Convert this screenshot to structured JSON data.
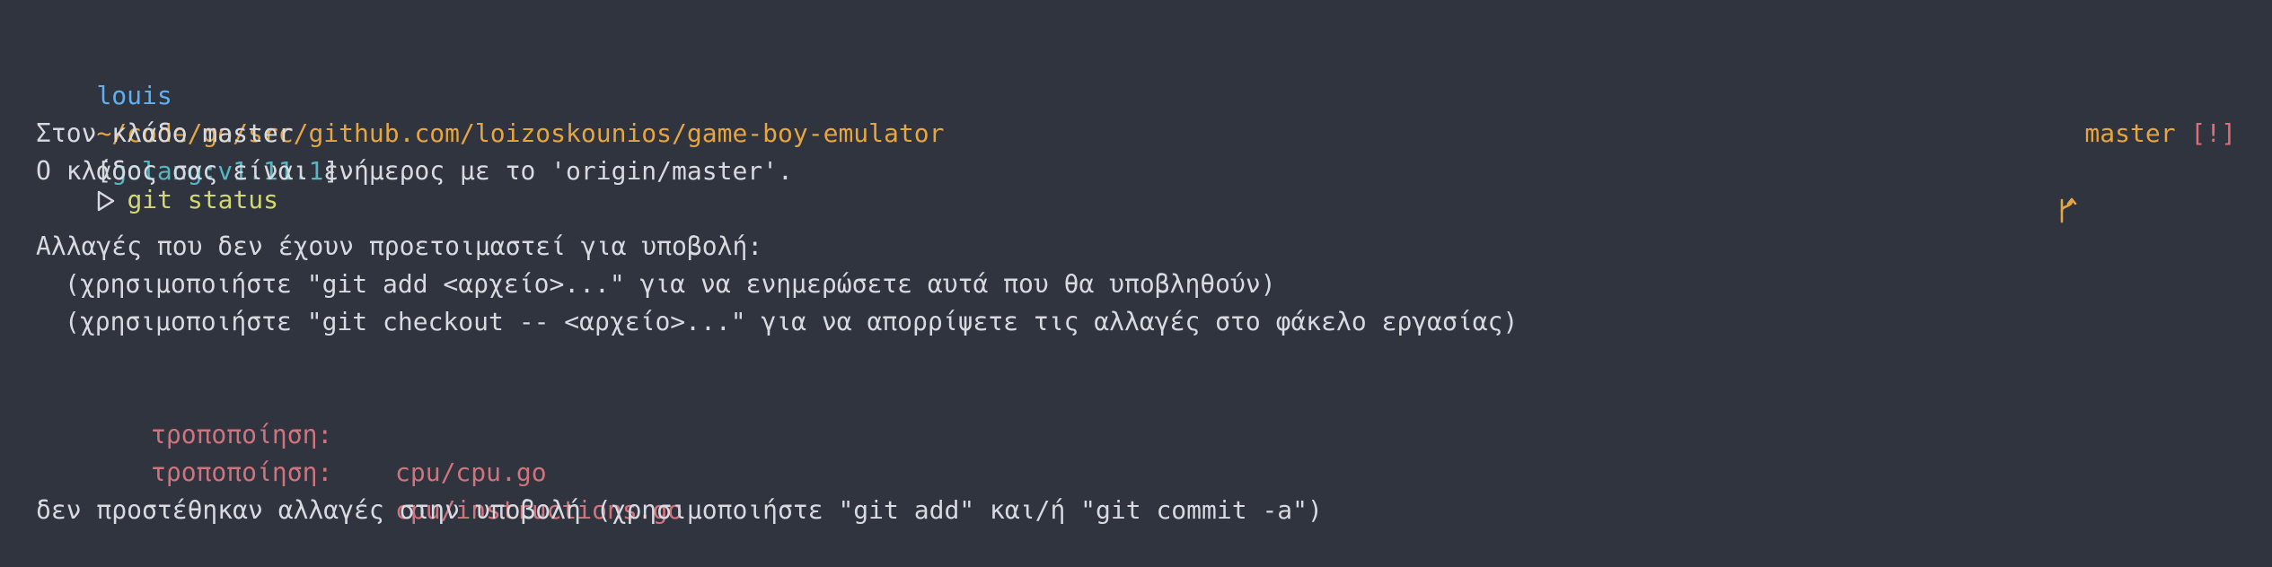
{
  "prompt": {
    "user": "louis",
    "path": "~/code/go/src/github.com/loizoskounios/game-boy-emulator",
    "env_open": "[",
    "env": "golang:v1.11.1",
    "env_close": "]",
    "command": "git status",
    "arrow_icon": "triangle-right-icon"
  },
  "git": {
    "branch_icon": "git-branch-icon",
    "branch": "master",
    "status": "[!]"
  },
  "output": {
    "line1": "Στον κλάδο master",
    "line2": "Ο κλάδος σας είναι ενήμερος με το 'origin/master'.",
    "line3": "Αλλαγές που δεν έχουν προετοιμαστεί για υποβολή:",
    "line4": "(χρησιμοποιήστε \"git add <αρχείο>...\" για να ενημερώσετε αυτά που θα υποβληθούν)",
    "line5": "(χρησιμοποιήστε \"git checkout -- <αρχείο>...\" για να απορρίψετε τις αλλαγές στο φάκελο εργασίας)",
    "modified": [
      {
        "label": "τροποποίηση:",
        "file": "cpu/cpu.go"
      },
      {
        "label": "τροποποίηση:",
        "file": "cpu/instructions.go"
      }
    ],
    "line_final": "δεν προστέθηκαν αλλαγές στην υποβολή (χρησιμοποιήστε \"git add\" και/ή \"git commit -a\")"
  },
  "colors": {
    "background": "#2f343f",
    "user": "#61afef",
    "path": "#e5a541",
    "env": "#56b6c2",
    "command": "#d3d76f",
    "modified": "#d0737d",
    "text": "#d7dae0"
  }
}
